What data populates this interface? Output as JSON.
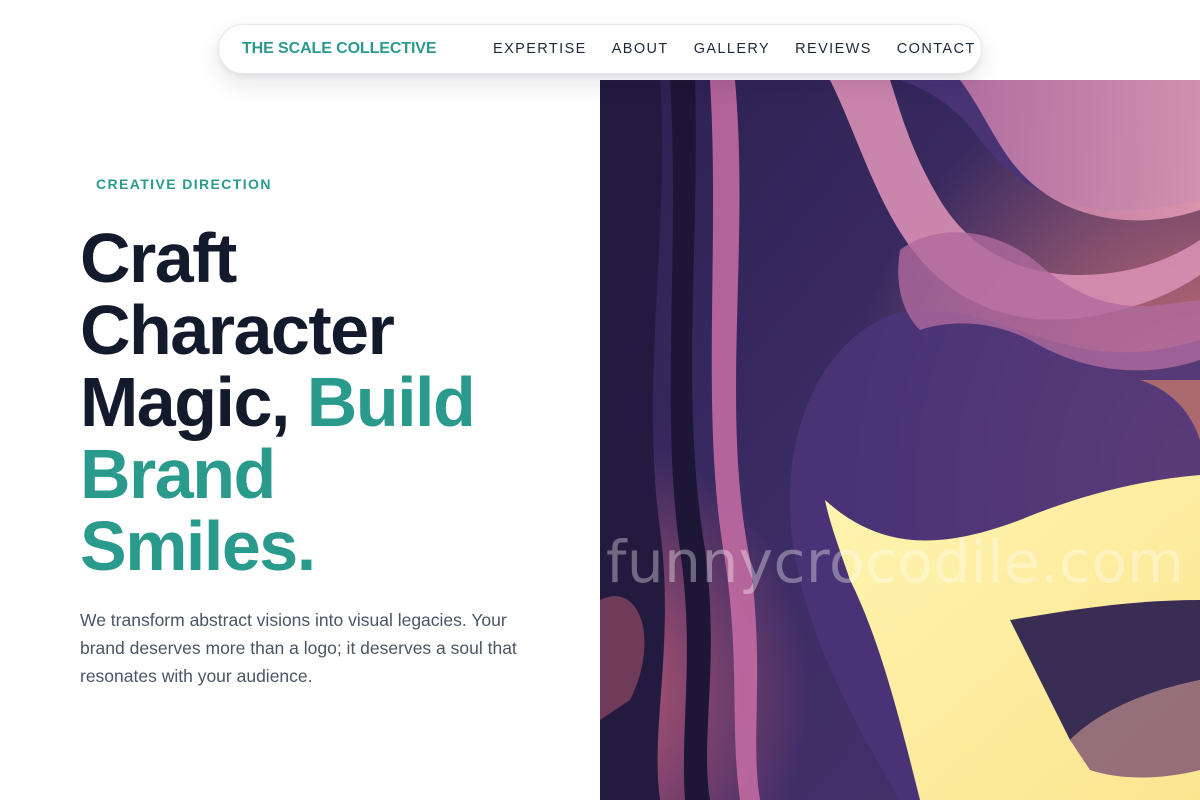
{
  "nav": {
    "brand": "THE SCALE COLLECTIVE",
    "links": [
      "EXPERTISE",
      "ABOUT",
      "GALLERY",
      "REVIEWS",
      "CONTACT"
    ]
  },
  "hero": {
    "eyebrow": "CREATIVE DIRECTION",
    "headline_dark_1": "Craft",
    "headline_dark_2": "Character",
    "headline_dark_3": "Magic,",
    "headline_accent_1": "Build",
    "headline_accent_2": "Brand",
    "headline_accent_3": "Smiles.",
    "subtext": "We transform abstract visions into visual legacies. Your brand deserves more than a logo; it deserves a soul that resonates with your audience."
  },
  "art": {
    "watermark": "funnycrocodile.com"
  },
  "colors": {
    "accent": "#2a9a8c",
    "heading": "#131a2b",
    "body_text": "#4b5563"
  }
}
